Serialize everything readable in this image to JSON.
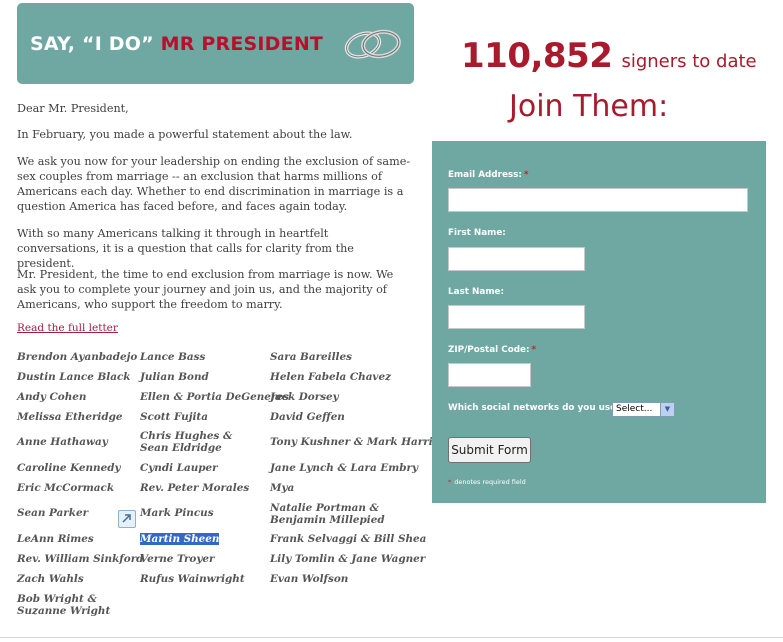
{
  "banner": {
    "title_white": "SAY, “I DO”",
    "title_red": "MR PRESIDENT"
  },
  "letter": {
    "greeting": "Dear Mr. President,",
    "paragraphs": [
      "In February, you made a powerful statement about the law.",
      "We ask you now for your leadership on ending the exclusion of same-sex couples from marriage -- an exclusion that harms millions of Americans each day. Whether to end discrimination in marriage is a question America has faced before, and faces again today.",
      "With so many Americans talking it through in heartfelt conversations, it is a question that calls for clarity from the president.",
      "Mr. President, the time to end exclusion from marriage is now. We ask you to complete your journey and join us, and the majority of Americans, who support the freedom to marry."
    ],
    "read_link": "Read the full letter"
  },
  "signers": [
    "Brendon Ayanbadejo",
    "Lance Bass",
    "Sara Bareilles",
    "Dustin Lance Black",
    "Julian Bond",
    "Helen Fabela Chavez",
    "Andy Cohen",
    "Ellen & Portia DeGeneres",
    "Jack Dorsey",
    "Melissa Etheridge",
    "Scott Fujita",
    "David Geffen",
    "Anne Hathaway",
    "Chris Hughes & Sean Eldridge",
    "Tony Kushner & Mark Harris",
    "Caroline Kennedy",
    "Cyndi Lauper",
    "Jane Lynch & Lara Embry",
    "Eric McCormack",
    "Rev. Peter Morales",
    "Mya",
    "Sean Parker",
    "Mark Pincus",
    "Natalie Portman & Benjamin Millepied",
    "LeAnn Rimes",
    "Martin Sheen",
    "Frank Selvaggi & Bill Shea",
    "Rev. William Sinkford",
    "Verne Troyer",
    "Lily Tomlin & Jane Wagner",
    "Zach Wahls",
    "Rufus Wainwright",
    "Evan Wolfson",
    "Bob Wright & Suzanne Wright"
  ],
  "signup": {
    "count": "110,852",
    "count_suffix": "signers to date",
    "join_title": "Join Them:",
    "fields": {
      "email_label": "Email Address:",
      "first_name_label": "First Name:",
      "last_name_label": "Last Name:",
      "zip_label": "ZIP/Postal Code:"
    },
    "required_mark": "*",
    "social_label": "Which social networks do you use?",
    "social_selected": "Select...",
    "submit_label": "Submit Form",
    "footnote": "denotes required field"
  },
  "colors": {
    "teal": "#6fa8a2",
    "accent_red": "#a81a2c",
    "highlight": "#316ac5"
  }
}
